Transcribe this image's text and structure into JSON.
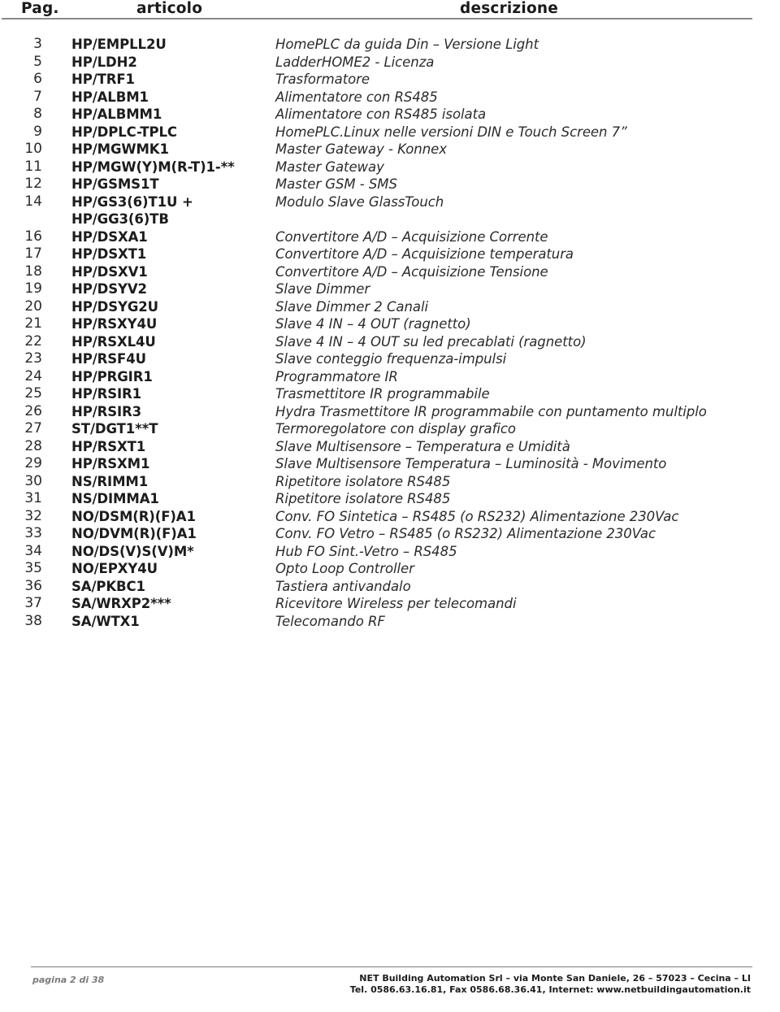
{
  "header": {
    "col_page": "Pag.",
    "col_article": "articolo",
    "col_description": "descrizione"
  },
  "rows": [
    {
      "page": "3",
      "article": "HP/EMPLL2U",
      "article2": "",
      "description": "HomePLC da guida Din – Versione Light"
    },
    {
      "page": "5",
      "article": "HP/LDH2",
      "article2": "",
      "description": "LadderHOME2 - Licenza"
    },
    {
      "page": "6",
      "article": "HP/TRF1",
      "article2": "",
      "description": "Trasformatore"
    },
    {
      "page": "7",
      "article": "HP/ALBM1",
      "article2": "",
      "description": "Alimentatore con RS485"
    },
    {
      "page": "8",
      "article": "HP/ALBMM1",
      "article2": "",
      "description": "Alimentatore con RS485 isolata"
    },
    {
      "page": "9",
      "article": "HP/DPLC-TPLC",
      "article2": "",
      "description": "HomePLC.Linux nelle versioni DIN e Touch Screen 7”"
    },
    {
      "page": "10",
      "article": "HP/MGWMK1",
      "article2": "",
      "description": "Master Gateway - Konnex"
    },
    {
      "page": "11",
      "article": "HP/MGW(Y)M(R-T)1-**",
      "article2": "",
      "description": "Master Gateway"
    },
    {
      "page": "12",
      "article": "HP/GSMS1T",
      "article2": "",
      "description": "Master GSM - SMS"
    },
    {
      "page": "14",
      "article": "HP/GS3(6)T1U +",
      "article2": "HP/GG3(6)TB",
      "description": "Modulo Slave GlassTouch"
    },
    {
      "page": "16",
      "article": "HP/DSXA1",
      "article2": "",
      "description": "Convertitore A/D – Acquisizione Corrente"
    },
    {
      "page": "17",
      "article": "HP/DSXT1",
      "article2": "",
      "description": "Convertitore A/D – Acquisizione temperatura"
    },
    {
      "page": "18",
      "article": "HP/DSXV1",
      "article2": "",
      "description": "Convertitore A/D – Acquisizione Tensione"
    },
    {
      "page": "19",
      "article": "HP/DSYV2",
      "article2": "",
      "description": "Slave Dimmer"
    },
    {
      "page": "20",
      "article": "HP/DSYG2U",
      "article2": "",
      "description": "Slave Dimmer 2 Canali"
    },
    {
      "page": "21",
      "article": "HP/RSXY4U",
      "article2": "",
      "description": "Slave 4 IN – 4 OUT (ragnetto)"
    },
    {
      "page": "22",
      "article": "HP/RSXL4U",
      "article2": "",
      "description": "Slave 4 IN – 4 OUT  su led precablati (ragnetto)"
    },
    {
      "page": "23",
      "article": "HP/RSF4U",
      "article2": "",
      "description": "Slave conteggio frequenza-impulsi"
    },
    {
      "page": "24",
      "article": "HP/PRGIR1",
      "article2": "",
      "description": "Programmatore IR"
    },
    {
      "page": "25",
      "article": "HP/RSIR1",
      "article2": "",
      "description": "Trasmettitore IR programmabile"
    },
    {
      "page": "26",
      "article": "HP/RSIR3",
      "article2": "",
      "description": "Hydra Trasmettitore IR programmabile con puntamento multiplo"
    },
    {
      "page": "27",
      "article": "ST/DGT1**T",
      "article2": "",
      "description": "Termoregolatore con display grafico"
    },
    {
      "page": "28",
      "article": "HP/RSXT1",
      "article2": "",
      "description": "Slave Multisensore – Temperatura e Umidità"
    },
    {
      "page": "29",
      "article": "HP/RSXM1",
      "article2": "",
      "description": "Slave Multisensore Temperatura – Luminosità - Movimento"
    },
    {
      "page": "30",
      "article": "NS/RIMM1",
      "article2": "",
      "description": "Ripetitore isolatore RS485"
    },
    {
      "page": "31",
      "article": "NS/DIMMA1",
      "article2": "",
      "description": "Ripetitore isolatore RS485"
    },
    {
      "page": "32",
      "article": "NO/DSM(R)(F)A1",
      "article2": "",
      "description": "Conv. FO Sintetica – RS485 (o RS232) Alimentazione 230Vac"
    },
    {
      "page": "33",
      "article": "NO/DVM(R)(F)A1",
      "article2": "",
      "description": "Conv. FO Vetro – RS485 (o RS232) Alimentazione 230Vac"
    },
    {
      "page": "34",
      "article": "NO/DS(V)S(V)M*",
      "article2": "",
      "description": "Hub FO Sint.-Vetro – RS485"
    },
    {
      "page": "35",
      "article": "NO/EPXY4U",
      "article2": "",
      "description": "Opto Loop Controller"
    },
    {
      "page": "36",
      "article": "SA/PKBC1",
      "article2": "",
      "description": "Tastiera antivandalo"
    },
    {
      "page": "37",
      "article": "SA/WRXP2***",
      "article2": "",
      "description": "Ricevitore Wireless per telecomandi"
    },
    {
      "page": "38",
      "article": "SA/WTX1",
      "article2": "",
      "description": "Telecomando RF"
    }
  ],
  "footer": {
    "page_label": "pagina 2 di 38",
    "company_line1": "NET Building Automation Srl – via Monte San Daniele, 26 – 57023 – Cecina – LI",
    "company_line2": "Tel. 0586.63.16.81, Fax 0586.68.36.41, Internet: www.netbuildingautomation.it"
  }
}
